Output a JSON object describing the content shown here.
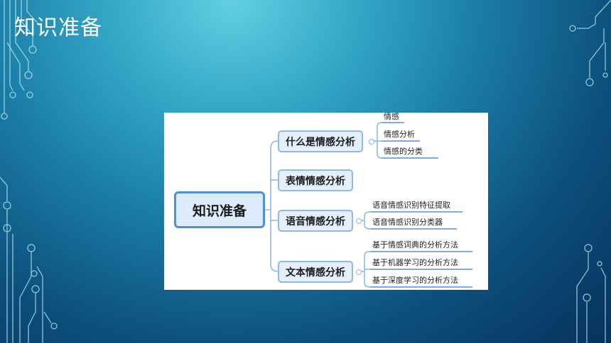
{
  "slide": {
    "title": "知识准备"
  },
  "mindmap": {
    "root": "知识准备",
    "branches": [
      {
        "label": "什么是情感分析",
        "children": [
          "情感",
          "情感分析",
          "情感的分类"
        ]
      },
      {
        "label": "表情情感分析",
        "children": []
      },
      {
        "label": "语音情感分析",
        "children": [
          "语音情感识别特征提取",
          "语音情感识别分类器"
        ]
      },
      {
        "label": "文本情感分析",
        "children": [
          "基于情感词典的分析方法",
          "基于机器学习的分析方法",
          "基于深度学习的分析方法"
        ]
      }
    ]
  },
  "colors": {
    "background_light": "#63d0e2",
    "background_dark": "#06325c",
    "node_border": "#4f8fe0",
    "node_fill": "#dcecfa",
    "connector": "#8fb9ea",
    "leaf_underline": "#4f8fe0"
  }
}
